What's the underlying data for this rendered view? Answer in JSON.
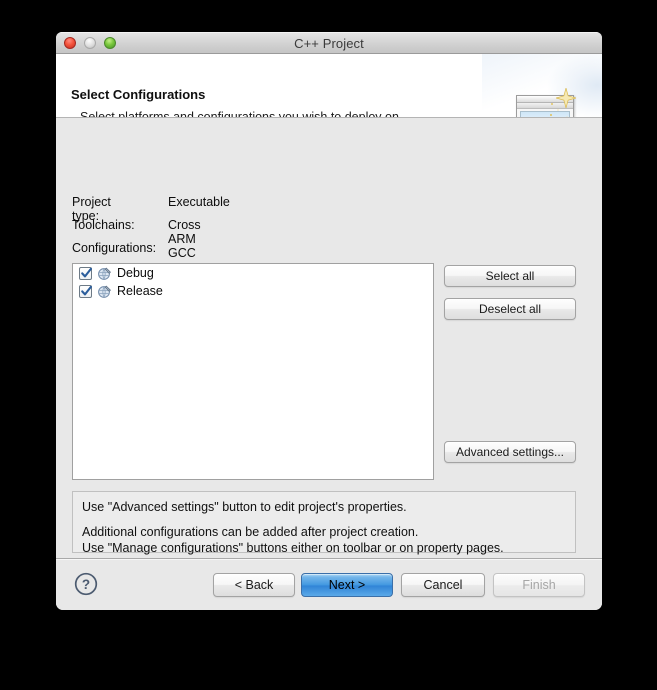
{
  "window": {
    "title": "C++ Project",
    "traffic_lights": [
      "close-button",
      "minimize-button",
      "zoom-button"
    ]
  },
  "header": {
    "title": "Select Configurations",
    "subtitle": "Select platforms and configurations you wish to deploy on",
    "banner_icon": "wizard-window-sparkle-icon"
  },
  "form": {
    "project_type_label": "Project type:",
    "project_type_value": "Executable",
    "toolchains_label": "Toolchains:",
    "toolchains_value": "Cross ARM GCC",
    "configurations_label": "Configurations:"
  },
  "configurations": [
    {
      "label": "Debug",
      "checked": true,
      "icon": "configuration-icon"
    },
    {
      "label": "Release",
      "checked": true,
      "icon": "configuration-icon"
    }
  ],
  "side_buttons": {
    "select_all": "Select all",
    "deselect_all": "Deselect all",
    "advanced_settings": "Advanced settings..."
  },
  "info_panel": {
    "line1": "Use \"Advanced settings\" button to edit project's properties.",
    "line2": "Additional configurations can be added after project creation.",
    "line3": "Use \"Manage configurations\" buttons either on toolbar or on property pages."
  },
  "footer": {
    "help": "help-icon",
    "back": "< Back",
    "next": "Next >",
    "cancel": "Cancel",
    "finish": "Finish"
  },
  "colors": {
    "default_button_accent": "#3f96e0",
    "window_background": "#e8e8e8",
    "checkbox_check": "#2a5d9c",
    "desktop_background": "#000000"
  }
}
